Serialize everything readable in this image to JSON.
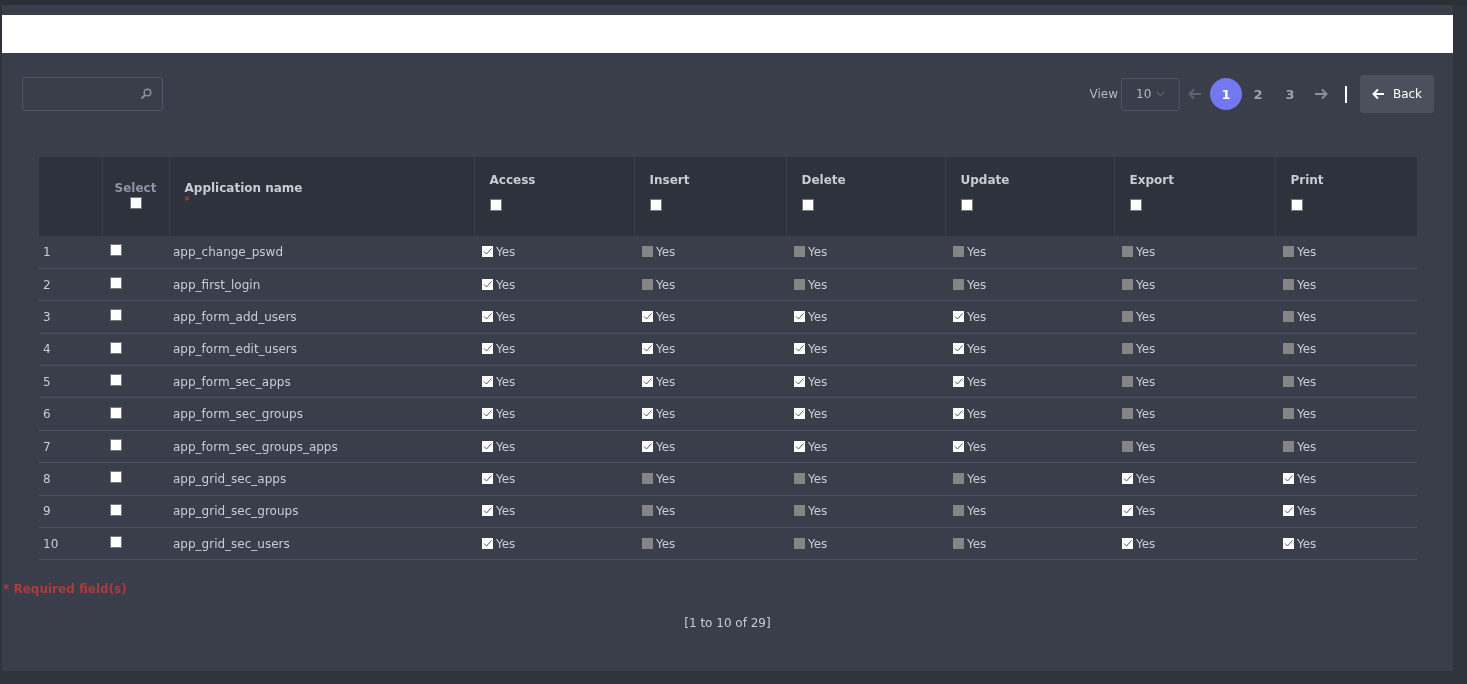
{
  "pagination": {
    "view_label": "View",
    "page_size": "10",
    "pages": [
      {
        "label": "1",
        "selected": true
      },
      {
        "label": "2",
        "selected": false
      },
      {
        "label": "3",
        "selected": false
      }
    ]
  },
  "back_button": "Back",
  "table": {
    "select_column": {
      "label": "Select",
      "checked": false
    },
    "name_column": {
      "label": "Application name",
      "required_mark": "*"
    },
    "permission_columns": [
      {
        "label": "Access",
        "checked": false
      },
      {
        "label": "Insert",
        "checked": false
      },
      {
        "label": "Delete",
        "checked": false
      },
      {
        "label": "Update",
        "checked": false
      },
      {
        "label": "Export",
        "checked": false
      },
      {
        "label": "Print",
        "checked": false
      }
    ],
    "rows": [
      {
        "index": "1",
        "selected": false,
        "name": "app_change_pswd",
        "permissions": [
          {
            "label": "Yes",
            "checked": true
          },
          {
            "label": "Yes",
            "checked": false
          },
          {
            "label": "Yes",
            "checked": false
          },
          {
            "label": "Yes",
            "checked": false
          },
          {
            "label": "Yes",
            "checked": false
          },
          {
            "label": "Yes",
            "checked": false
          }
        ]
      },
      {
        "index": "2",
        "selected": false,
        "name": "app_first_login",
        "permissions": [
          {
            "label": "Yes",
            "checked": true
          },
          {
            "label": "Yes",
            "checked": false
          },
          {
            "label": "Yes",
            "checked": false
          },
          {
            "label": "Yes",
            "checked": false
          },
          {
            "label": "Yes",
            "checked": false
          },
          {
            "label": "Yes",
            "checked": false
          }
        ]
      },
      {
        "index": "3",
        "selected": false,
        "name": "app_form_add_users",
        "permissions": [
          {
            "label": "Yes",
            "checked": true
          },
          {
            "label": "Yes",
            "checked": true
          },
          {
            "label": "Yes",
            "checked": true
          },
          {
            "label": "Yes",
            "checked": true
          },
          {
            "label": "Yes",
            "checked": false
          },
          {
            "label": "Yes",
            "checked": false
          }
        ]
      },
      {
        "index": "4",
        "selected": false,
        "name": "app_form_edit_users",
        "permissions": [
          {
            "label": "Yes",
            "checked": true
          },
          {
            "label": "Yes",
            "checked": true
          },
          {
            "label": "Yes",
            "checked": true
          },
          {
            "label": "Yes",
            "checked": true
          },
          {
            "label": "Yes",
            "checked": false
          },
          {
            "label": "Yes",
            "checked": false
          }
        ]
      },
      {
        "index": "5",
        "selected": false,
        "name": "app_form_sec_apps",
        "permissions": [
          {
            "label": "Yes",
            "checked": true
          },
          {
            "label": "Yes",
            "checked": true
          },
          {
            "label": "Yes",
            "checked": true
          },
          {
            "label": "Yes",
            "checked": true
          },
          {
            "label": "Yes",
            "checked": false
          },
          {
            "label": "Yes",
            "checked": false
          }
        ]
      },
      {
        "index": "6",
        "selected": false,
        "name": "app_form_sec_groups",
        "permissions": [
          {
            "label": "Yes",
            "checked": true
          },
          {
            "label": "Yes",
            "checked": true
          },
          {
            "label": "Yes",
            "checked": true
          },
          {
            "label": "Yes",
            "checked": true
          },
          {
            "label": "Yes",
            "checked": false
          },
          {
            "label": "Yes",
            "checked": false
          }
        ]
      },
      {
        "index": "7",
        "selected": false,
        "name": "app_form_sec_groups_apps",
        "permissions": [
          {
            "label": "Yes",
            "checked": true
          },
          {
            "label": "Yes",
            "checked": true
          },
          {
            "label": "Yes",
            "checked": true
          },
          {
            "label": "Yes",
            "checked": true
          },
          {
            "label": "Yes",
            "checked": false
          },
          {
            "label": "Yes",
            "checked": false
          }
        ]
      },
      {
        "index": "8",
        "selected": false,
        "name": "app_grid_sec_apps",
        "permissions": [
          {
            "label": "Yes",
            "checked": true
          },
          {
            "label": "Yes",
            "checked": false
          },
          {
            "label": "Yes",
            "checked": false
          },
          {
            "label": "Yes",
            "checked": false
          },
          {
            "label": "Yes",
            "checked": true
          },
          {
            "label": "Yes",
            "checked": true
          }
        ]
      },
      {
        "index": "9",
        "selected": false,
        "name": "app_grid_sec_groups",
        "permissions": [
          {
            "label": "Yes",
            "checked": true
          },
          {
            "label": "Yes",
            "checked": false
          },
          {
            "label": "Yes",
            "checked": false
          },
          {
            "label": "Yes",
            "checked": false
          },
          {
            "label": "Yes",
            "checked": true
          },
          {
            "label": "Yes",
            "checked": true
          }
        ]
      },
      {
        "index": "10",
        "selected": false,
        "name": "app_grid_sec_users",
        "permissions": [
          {
            "label": "Yes",
            "checked": true
          },
          {
            "label": "Yes",
            "checked": false
          },
          {
            "label": "Yes",
            "checked": false
          },
          {
            "label": "Yes",
            "checked": false
          },
          {
            "label": "Yes",
            "checked": true
          },
          {
            "label": "Yes",
            "checked": true
          }
        ]
      }
    ]
  },
  "required_note": "* Required field(s)",
  "record_count": "[1 to 10 of 29]"
}
